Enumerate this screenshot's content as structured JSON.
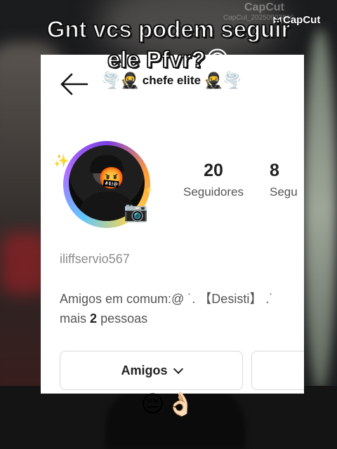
{
  "overlay": {
    "caption_line1": "Gnt vcs podem seguir",
    "caption_line2": "ele Pfvr?",
    "caption_emoji": "🙃",
    "bottom_emojis": "😔👌🏻",
    "capcut_watermark": "CapCut",
    "capcut_date": "CapCut_20250903896",
    "capcut_logo": "CapCut"
  },
  "profile": {
    "title_prefix_emojis": "🌪️🥷",
    "title": "chefe elite",
    "title_suffix_emojis": "🥷🌪️",
    "avatar_emoji": "🤬",
    "stats": [
      {
        "value": "20",
        "label": "Seguidores"
      },
      {
        "value": "8",
        "label": "Segu"
      }
    ],
    "username": "iliffservio567",
    "mutual_prefix": "Amigos em comum:@ ˙. 【Desisti】 .˙",
    "mutual_more": "mais",
    "mutual_count": "2",
    "mutual_suffix": "pessoas",
    "buttons": {
      "friends_label": "Amigos",
      "second_label": ""
    }
  },
  "icons": {
    "back": "back-arrow-icon",
    "dropdown": "chevron-down-icon",
    "camera": "camera-icon"
  }
}
